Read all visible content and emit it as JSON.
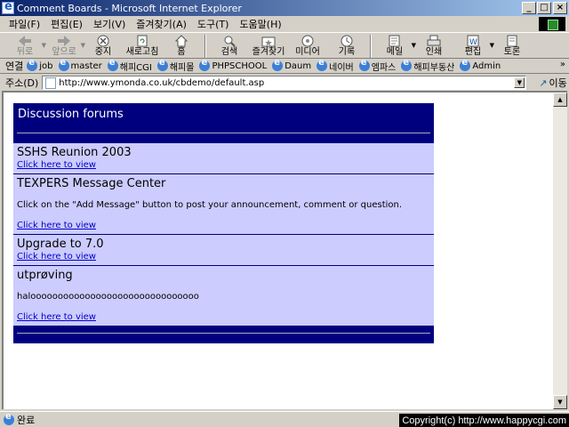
{
  "window": {
    "title": "Comment Boards - Microsoft Internet Explorer"
  },
  "menu": {
    "items": [
      "파일(F)",
      "편집(E)",
      "보기(V)",
      "즐겨찾기(A)",
      "도구(T)",
      "도움말(H)"
    ]
  },
  "toolbar": {
    "back": "뒤로",
    "forward": "앞으로",
    "stop": "중지",
    "refresh": "새로고침",
    "home": "홈",
    "search": "검색",
    "favorites": "즐겨찾기",
    "media": "미디어",
    "history": "기록",
    "mail": "메일",
    "print": "인쇄",
    "edit": "편집",
    "discuss": "토론"
  },
  "links": {
    "label": "연결",
    "items": [
      "job",
      "master",
      "해피CGI",
      "해피몰",
      "PHPSCHOOL",
      "Daum",
      "네이버",
      "엠파스",
      "해피부동산",
      "Admin"
    ],
    "more": "»"
  },
  "address": {
    "label": "주소(D)",
    "url": "http://www.ymonda.co.uk/cbdemo/default.asp",
    "go": "이동"
  },
  "forum": {
    "title": "Discussion forums",
    "boards": [
      {
        "title": "SSHS Reunion 2003",
        "desc": "",
        "link": "Click here to view"
      },
      {
        "title": "TEXPERS Message Center",
        "desc": "Click on the \"Add Message\" button to post your announcement, comment or question.",
        "link": "Click here to view"
      },
      {
        "title": "Upgrade to 7.0",
        "desc": "",
        "link": "Click here to view"
      },
      {
        "title": "utprøving",
        "desc": "halooooooooooooooooooooooooooooooo",
        "link": "Click here to view"
      }
    ]
  },
  "status": {
    "text": "완료",
    "copyright": "Copyright(c) http://www.happycgi.com"
  }
}
